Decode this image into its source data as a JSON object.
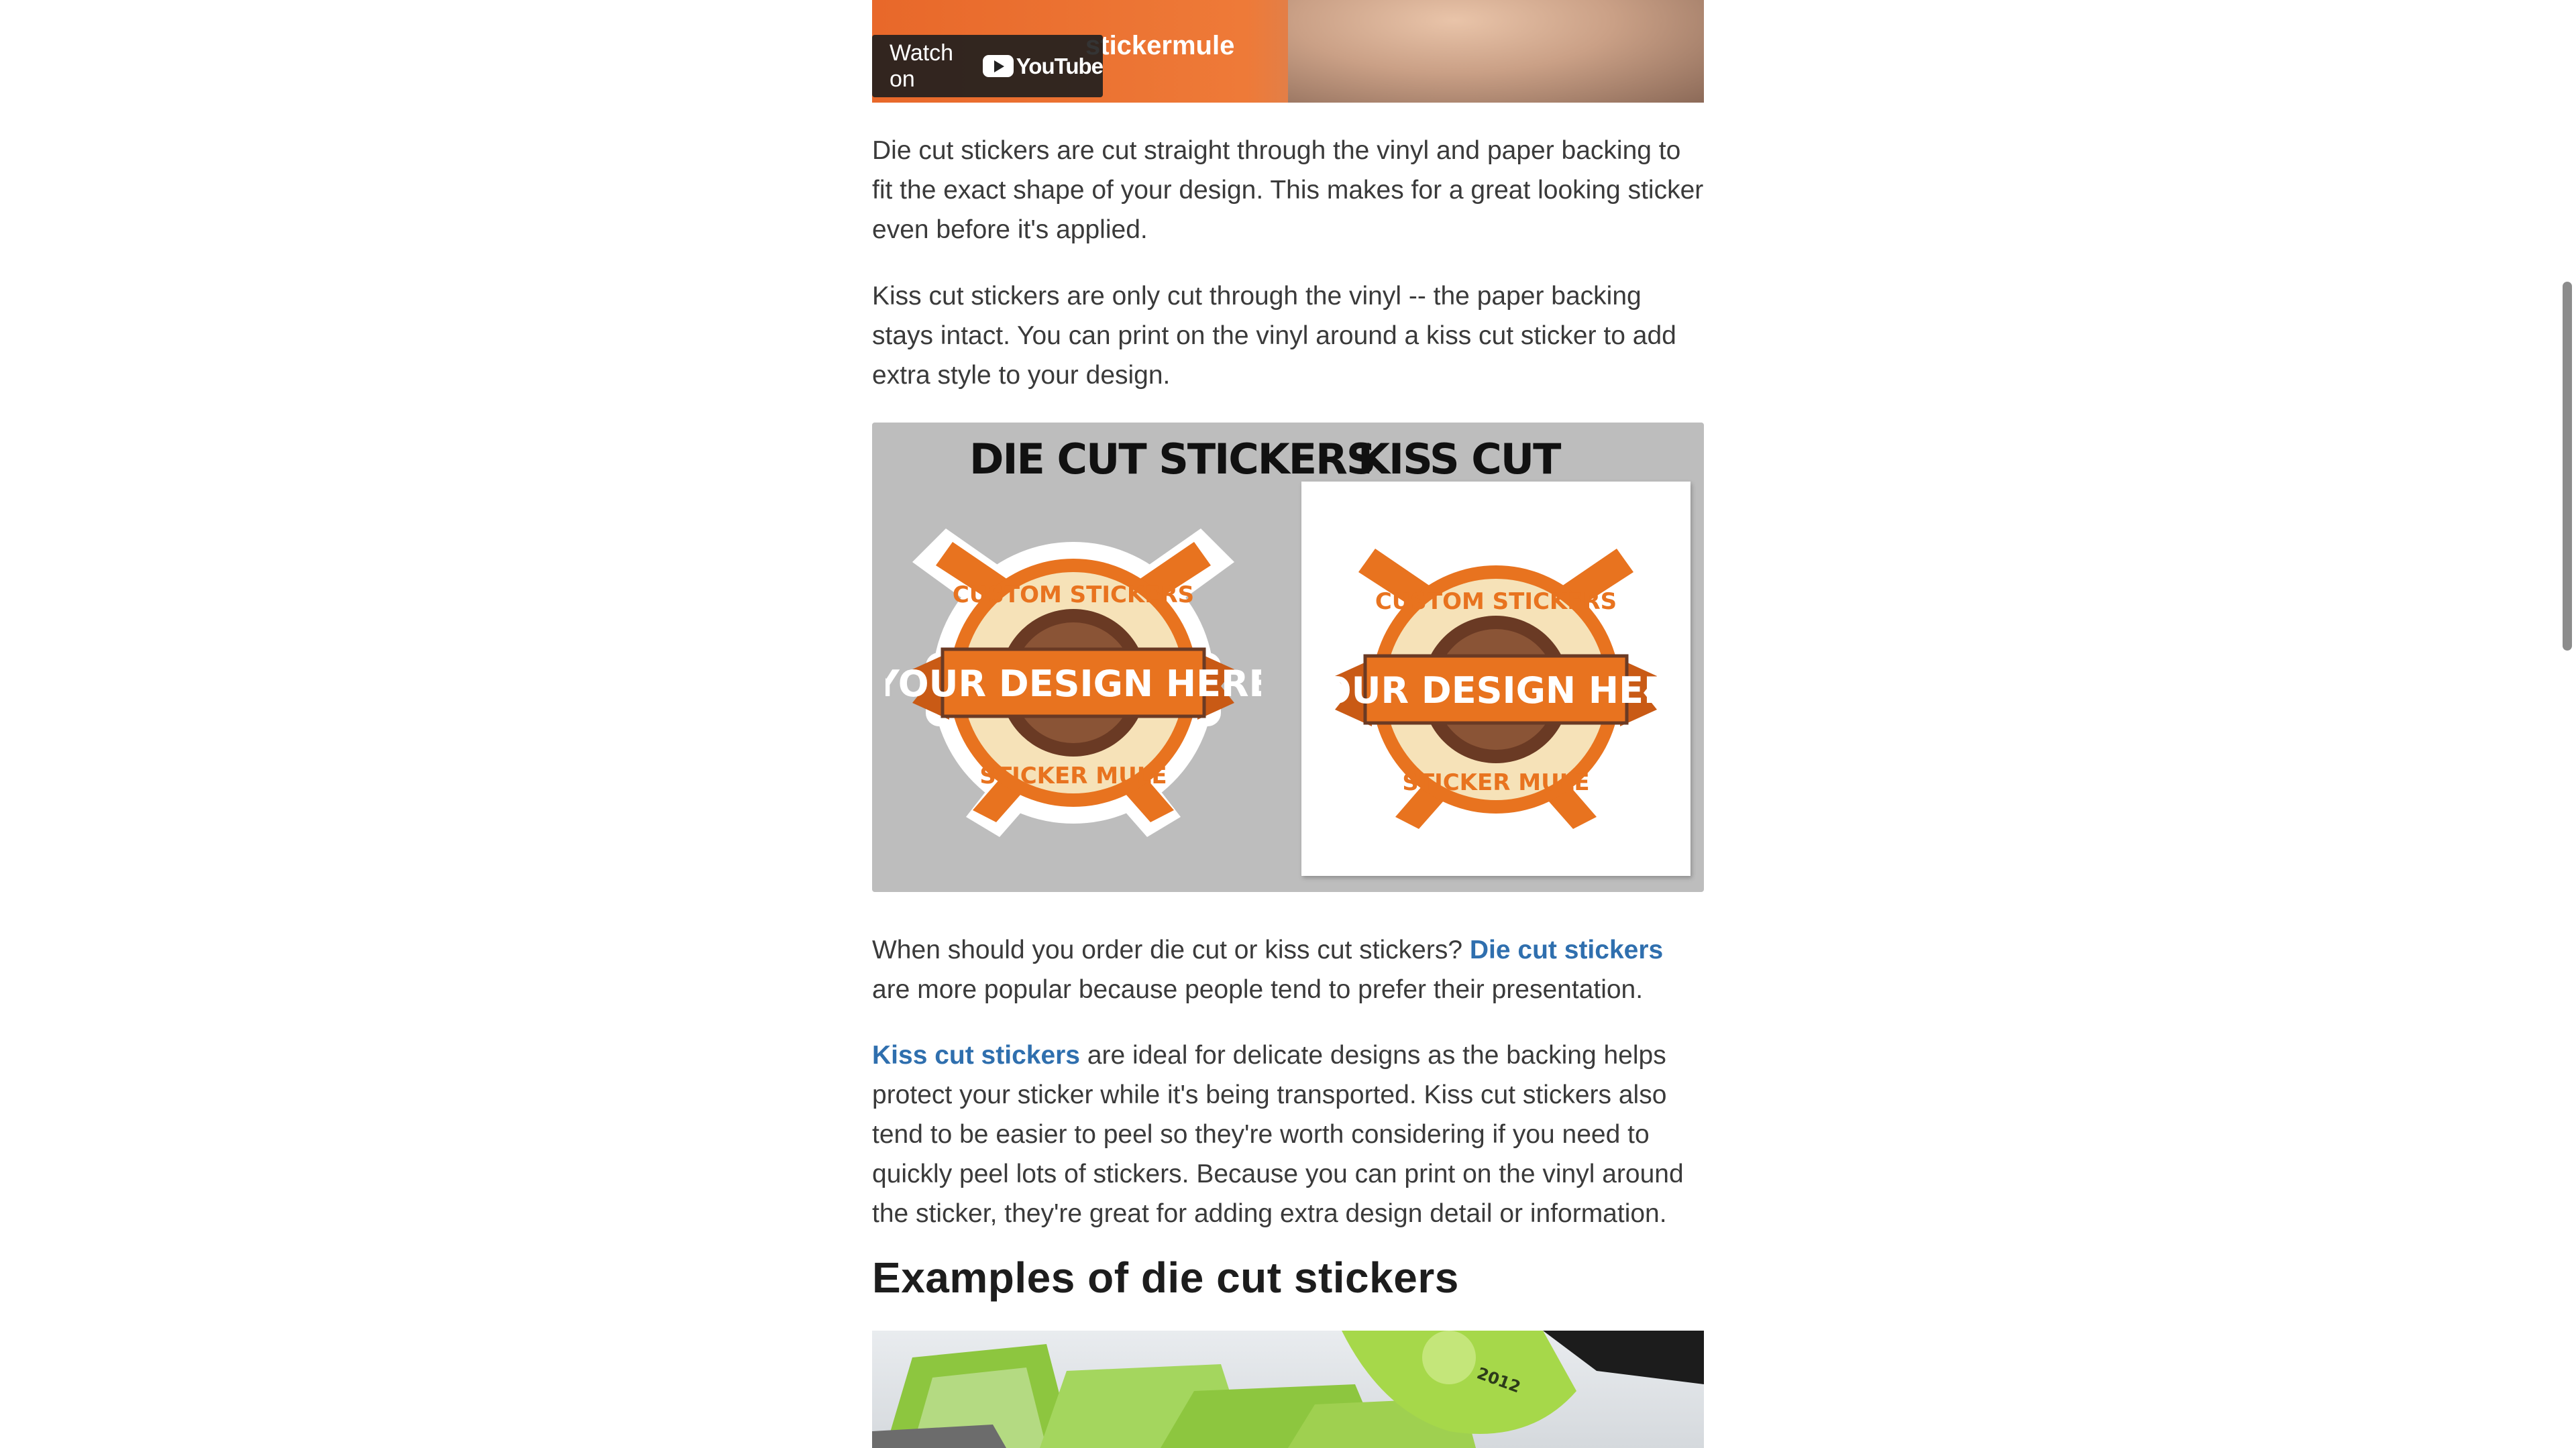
{
  "video": {
    "watch_label": "Watch on",
    "youtube_label": "YouTube",
    "brand_label": "stickermule"
  },
  "paragraphs": {
    "p1": "Die cut stickers are cut straight through the vinyl and paper backing to fit the exact shape of your design. This makes for a great looking sticker even before it's applied.",
    "p2": "Kiss cut stickers are only cut through the vinyl -- the paper backing stays intact. You can print on the vinyl around a kiss cut sticker to add extra style to your design.",
    "p3_before": "When should you order die cut or kiss cut stickers? ",
    "p3_link": "Die cut stickers",
    "p3_after": " are more popular because people tend to prefer their presentation.",
    "p4_link": "Kiss cut stickers",
    "p4_after": " are ideal for delicate designs as the backing helps protect your sticker while it's being transported. Kiss cut stickers also tend to be easier to peel so they're worth considering if you need to quickly peel lots of stickers. Because you can print on the vinyl around the sticker, they're great for adding extra design detail or information."
  },
  "comparison": {
    "left_title": "DIE CUT STICKERS",
    "right_title": "KISS CUT STICKERS",
    "badge_top_text": "CUSTOM STICKERS",
    "badge_ribbon_text": "YOUR DESIGN HERE",
    "badge_bottom_text": "STICKER MULE"
  },
  "section": {
    "heading": "Examples of die cut stickers"
  },
  "examples_image": {
    "year_text": "2012"
  },
  "colors": {
    "link": "#2f6fae",
    "badge_orange": "#e8731f",
    "badge_brown": "#6a3a24",
    "badge_cream": "#f6e2b8",
    "sticker_green": "#8dc63f"
  }
}
